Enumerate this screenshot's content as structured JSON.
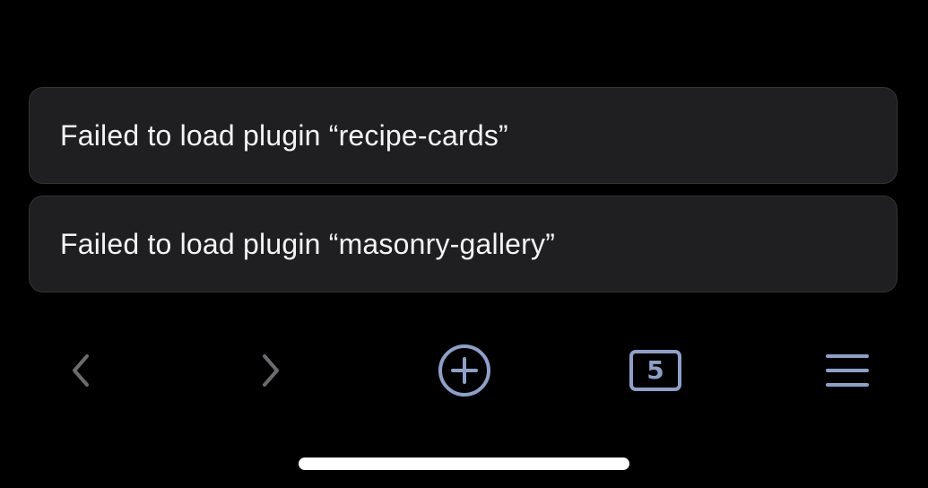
{
  "notifications": [
    {
      "message": "Failed to load plugin “recipe-cards”"
    },
    {
      "message": "Failed to load plugin “masonry-gallery”"
    }
  ],
  "toolbar": {
    "back_icon": "chevron-left-icon",
    "forward_icon": "chevron-right-icon",
    "new_tab_icon": "plus-circle-icon",
    "tab_count": "5",
    "menu_icon": "hamburger-menu-icon"
  },
  "colors": {
    "background": "#000000",
    "toast_background": "#1f1f21",
    "toast_text": "#f4f4f6",
    "accent": "#8fa0c8",
    "disabled_icon": "#6b6b70",
    "home_indicator": "#ffffff"
  }
}
